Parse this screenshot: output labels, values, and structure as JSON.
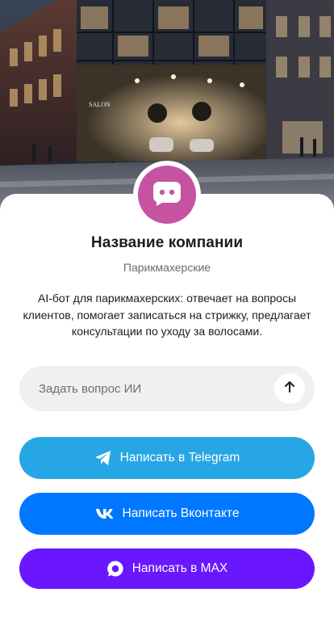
{
  "hero": {
    "image": "salon-storefront-illustration",
    "sign_text": "SALON"
  },
  "profile": {
    "avatar_icon": "chat-bot-icon",
    "company_name": "Название компании",
    "category": "Парикмахерские",
    "description": "AI-бот для парикмахерских: отвечает на вопросы клиентов, помогает записаться на стрижку, предлагает консультации по уходу за волосами."
  },
  "ask": {
    "placeholder": "Задать вопрос ИИ",
    "send_icon": "arrow-up-icon"
  },
  "buttons": [
    {
      "label": "Написать в Telegram",
      "icon": "telegram-icon",
      "color": "#27a6e5"
    },
    {
      "label": "Написать Вконтакте",
      "icon": "vk-icon",
      "color": "#0077ff"
    },
    {
      "label": "Написать в MAX",
      "icon": "max-icon",
      "color": "#6a16ff"
    }
  ],
  "colors": {
    "avatar_bg": "#c553a2",
    "card_bg": "#ffffff",
    "input_bg": "#f0f0f2"
  }
}
